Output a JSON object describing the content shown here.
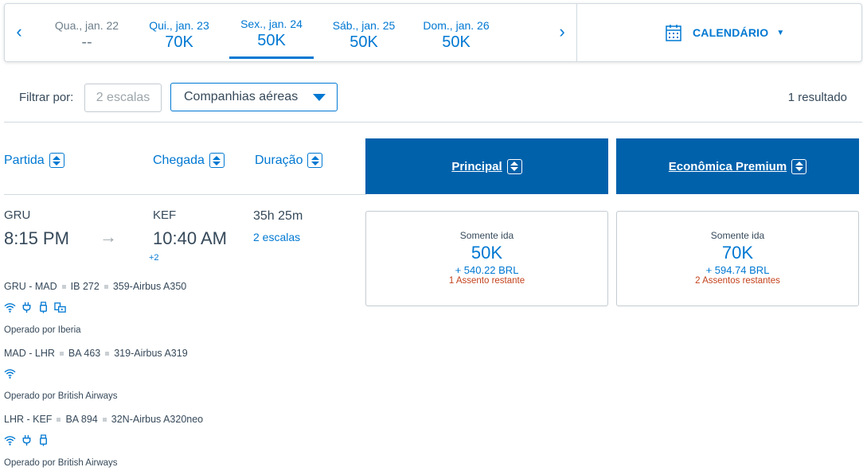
{
  "date_strip": {
    "prev_arrow": "‹",
    "next_arrow": "›",
    "dates": [
      {
        "label": "Qua., jan. 22",
        "price": "--"
      },
      {
        "label": "Qui., jan. 23",
        "price": "70K"
      },
      {
        "label": "Sex., jan. 24",
        "price": "50K"
      },
      {
        "label": "Sáb., jan. 25",
        "price": "50K"
      },
      {
        "label": "Dom., jan. 26",
        "price": "50K"
      }
    ],
    "calendar_label": "CALENDÁRIO"
  },
  "filters": {
    "label": "Filtrar por:",
    "stops_button": "2 escalas",
    "airlines_select": "Companhias aéreas",
    "result_count": "1 resultado"
  },
  "columns": {
    "departure": "Partida",
    "arrival": "Chegada",
    "duration": "Duração",
    "cabin_main": "Principal",
    "cabin_premium": "Econômica Premium"
  },
  "flight": {
    "origin": "GRU",
    "depart_time": "8:15 PM",
    "destination": "KEF",
    "arrive_time": "10:40 AM",
    "day_offset": "+2",
    "duration": "35h 25m",
    "stops": "2 escalas",
    "segments": [
      {
        "route": "GRU - MAD",
        "flight": "IB 272",
        "aircraft": "359-Airbus A350",
        "operated": "Operado por Iberia",
        "amenities": [
          "wifi-icon",
          "power-icon",
          "usb-icon",
          "entertainment-icon"
        ]
      },
      {
        "route": "MAD - LHR",
        "flight": "BA 463",
        "aircraft": "319-Airbus A319",
        "operated": "Operado por British Airways",
        "amenities": [
          "wifi-icon"
        ]
      },
      {
        "route": "LHR - KEF",
        "flight": "BA 894",
        "aircraft": "32N-Airbus A320neo",
        "operated": "Operado por British Airways",
        "amenities": [
          "wifi-icon",
          "power-icon",
          "usb-icon"
        ]
      }
    ]
  },
  "fares": {
    "main": {
      "type": "Somente ida",
      "miles": "50K",
      "cash": "+ 540.22 BRL",
      "seats": "1 Assento restante"
    },
    "premium": {
      "type": "Somente ida",
      "miles": "70K",
      "cash": "+ 594.74 BRL",
      "seats": "2 Assentos restantes"
    }
  },
  "colors": {
    "accent": "#0078d2",
    "cabin_header": "#0061ab",
    "seats_warning": "#c3431d"
  }
}
